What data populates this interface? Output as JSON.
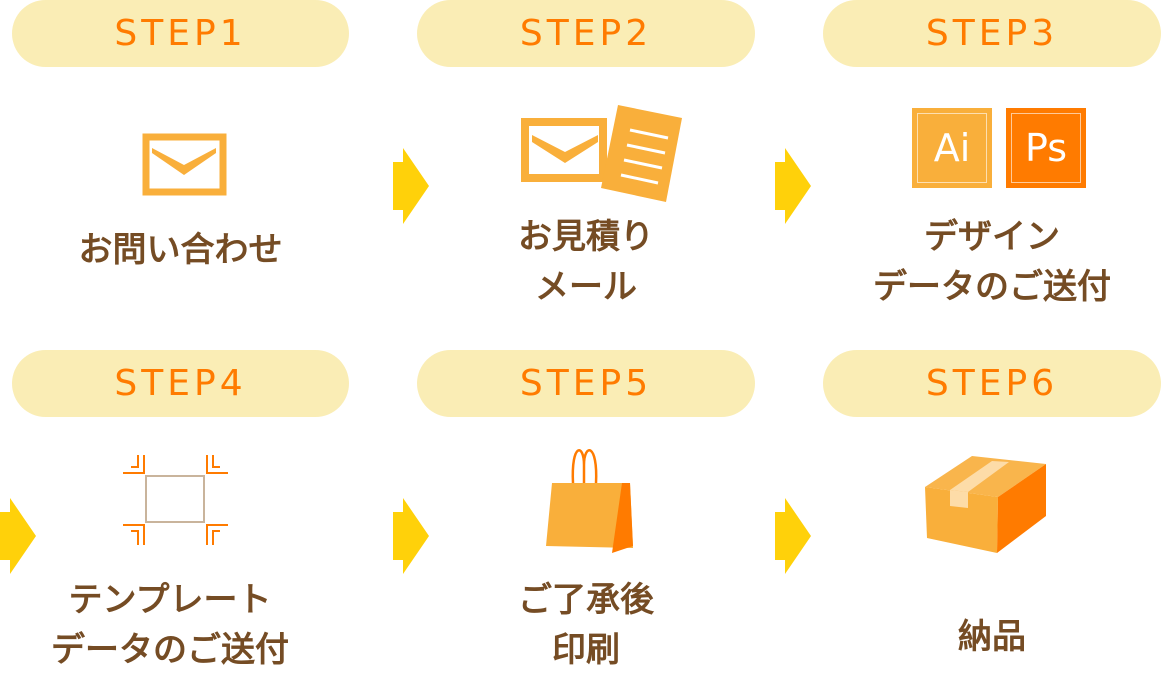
{
  "colors": {
    "pill_bg": "#FAEDB5",
    "step_text": "#FF7B00",
    "label_text": "#754C24",
    "arrow": "#FFD10A",
    "icon_light": "#F9AF3B",
    "icon_dark": "#FF7B00"
  },
  "steps": [
    {
      "title": "STEP1",
      "icon": "envelope-icon",
      "lines": [
        "お問い合わせ"
      ]
    },
    {
      "title": "STEP2",
      "icon": "envelope-document-icon",
      "lines": [
        "お見積り",
        "メール"
      ]
    },
    {
      "title": "STEP3",
      "icon": "ai-ps-icons",
      "lines": [
        "デザイン",
        "データのご送付"
      ],
      "apps": [
        "Ai",
        "Ps"
      ]
    },
    {
      "title": "STEP4",
      "icon": "crop-marks-icon",
      "lines": [
        "テンプレート",
        "データのご送付"
      ]
    },
    {
      "title": "STEP5",
      "icon": "shopping-bag-icon",
      "lines": [
        "ご了承後",
        "印刷"
      ]
    },
    {
      "title": "STEP6",
      "icon": "cardboard-box-icon",
      "lines": [
        "納品"
      ]
    }
  ]
}
